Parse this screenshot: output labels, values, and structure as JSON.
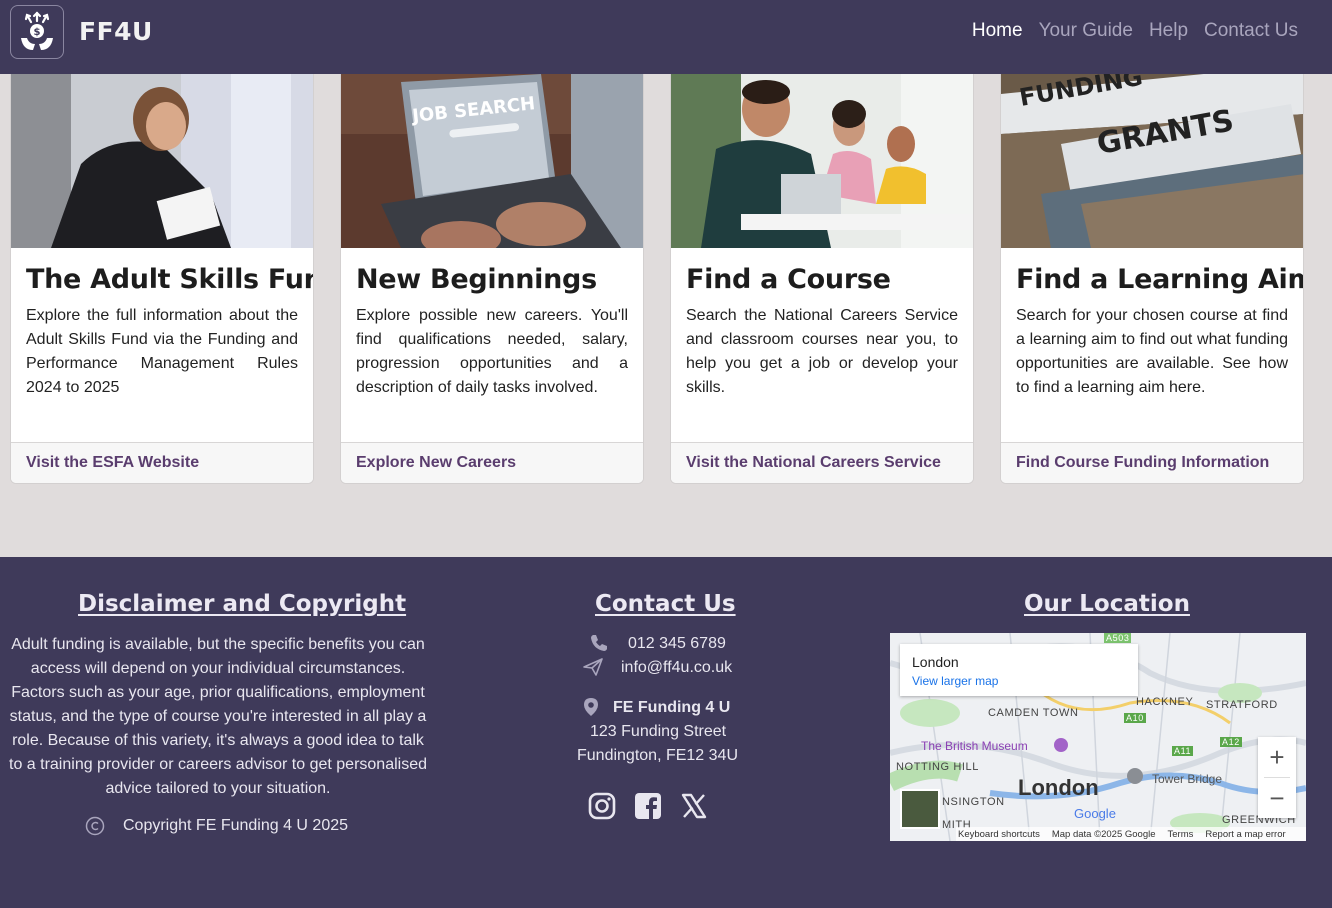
{
  "nav": {
    "brand": "FF4U",
    "links": [
      "Home",
      "Your Guide",
      "Help",
      "Contact Us"
    ],
    "active": "Home"
  },
  "cards": [
    {
      "title": "The Adult Skills Fund",
      "text": "Explore the full information about the Adult Skills Fund via the Funding and Performance Management Rules 2024 to 2025",
      "link": "Visit the ESFA Website"
    },
    {
      "title": "New Beginnings",
      "text": "Explore possible new careers. You'll find qualifications needed, salary, progression opportunities and a description of daily tasks involved.",
      "link": "Explore New Careers",
      "image_text": "JOB SEARCH"
    },
    {
      "title": "Find a Course",
      "text": "Search the National Careers Service and classroom courses near you, to help you get a job or develop your skills.",
      "link": "Visit the National Careers Service"
    },
    {
      "title": "Find a Learning Aim",
      "text": "Search for your chosen course at find a learning aim to find out what funding opportunities are available. See how to find a learning aim here.",
      "link": "Find Course Funding Information",
      "image_text_1": "FUNDING",
      "image_text_2": "GRANTS"
    }
  ],
  "footer": {
    "disclaimer_heading": "Disclaimer and Copyright",
    "disclaimer_text": "Adult funding is available, but the specific benefits you can access will depend on your individual circumstances. Factors such as your age, prior qualifications, employment status, and the type of course you're interested in all play a role. Because of this variety, it's always a good idea to talk to a training provider or careers advisor to get personalised advice tailored to your situation.",
    "copyright": "Copyright FE Funding 4 U 2025",
    "contact_heading": "Contact Us",
    "phone": "012 345 6789",
    "email": "info@ff4u.co.uk",
    "org": "FE Funding 4 U",
    "street": "123 Funding Street",
    "town": "Fundington, FE12 34U",
    "location_heading": "Our Location"
  },
  "map": {
    "place": "London",
    "view_larger": "View larger map",
    "big_label": "London",
    "labels": [
      "CAMDEN TOWN",
      "HACKNEY",
      "STRATFORD",
      "The British Museum",
      "NOTTING HILL",
      "Tower Bridge",
      "NSINGTON",
      "GREENWICH",
      "MITH",
      "A503",
      "A10",
      "A11",
      "A12"
    ],
    "footer": [
      "Keyboard shortcuts",
      "Map data ©2025 Google",
      "Terms",
      "Report a map error"
    ],
    "google": "Google",
    "zoom_in": "+",
    "zoom_out": "−"
  },
  "colors": {
    "nav_bg": "#3f3a5a",
    "page_bg": "#e0dcdc",
    "link": "#5a3d6e"
  }
}
